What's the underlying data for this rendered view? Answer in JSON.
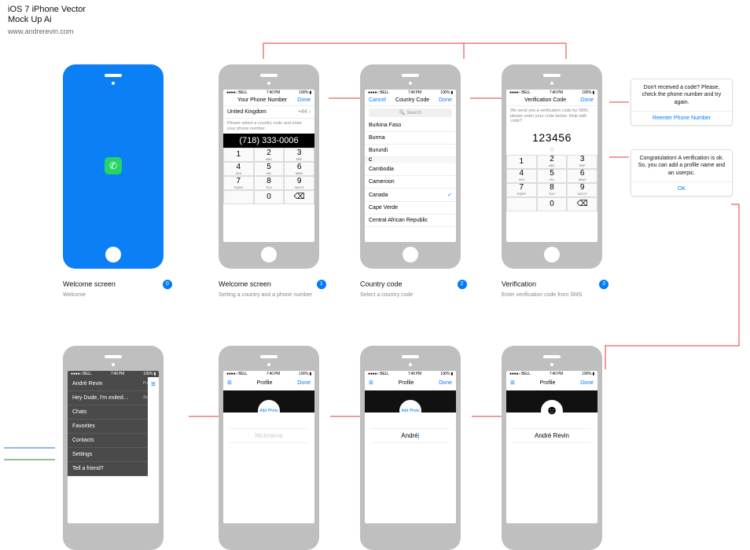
{
  "header": {
    "title": "iOS 7 iPhone Vector",
    "subtitle": "Mock Up Ai",
    "url": "www.andrerevin.com"
  },
  "statusbar": {
    "left": "●●●●○ BELL",
    "time": "7:40 PM",
    "right": "100%"
  },
  "screens": {
    "phone_number": {
      "nav_title": "Your Phone Number",
      "nav_done": "Done",
      "country": "United Kingdom",
      "prefix": "+44",
      "hint": "Please select a country code and enter your phone number.",
      "display": "(718) 333-0006"
    },
    "country_code": {
      "nav_cancel": "Cancel",
      "nav_title": "Country Code",
      "nav_done": "Done",
      "search_ph": "Search",
      "groupB": [
        "Burkina Faso",
        "Burma",
        "Burundi"
      ],
      "sect": "C",
      "groupC": [
        "Cambodia",
        "Cameroon",
        "Canada",
        "Cape Verde",
        "Central African Republic"
      ],
      "selected": "Canada"
    },
    "verification": {
      "nav_title": "Verification Code",
      "nav_done": "Done",
      "hint": "We send you a verification code by SMS, please enter your code below. Help with code?",
      "code": "123456"
    },
    "keypad": [
      {
        "d": "1",
        "l": ""
      },
      {
        "d": "2",
        "l": "ABC"
      },
      {
        "d": "3",
        "l": "DEF"
      },
      {
        "d": "4",
        "l": "GHI"
      },
      {
        "d": "5",
        "l": "JKL"
      },
      {
        "d": "6",
        "l": "MNO"
      },
      {
        "d": "7",
        "l": "PQRS"
      },
      {
        "d": "8",
        "l": "TUV"
      },
      {
        "d": "9",
        "l": "WXYZ"
      },
      {
        "d": "",
        "l": ""
      },
      {
        "d": "0",
        "l": ""
      },
      {
        "d": "⌫",
        "l": ""
      }
    ],
    "profile": {
      "nav_title": "Profile",
      "nav_done": "Done",
      "add_photo": "Add Photo",
      "nick_ph": "Nickname",
      "nick_typing": "André",
      "nick_full": "André Revin"
    }
  },
  "menu": {
    "name": "André Revin",
    "profile": "Profile",
    "status_text": "Hey Dude, I'm exited…",
    "status": "Status",
    "items": [
      "Chats",
      "Favorites",
      "Contacts",
      "Settings",
      "Tell a friend?"
    ]
  },
  "callouts": {
    "c1": {
      "text": "Don't received a code? Please, check the phone number and try again.",
      "btn": "Reenter Phone Number"
    },
    "c2": {
      "text": "Congratulation! A verification is ok. So, you can add a profile name and an userpic.",
      "btn": "OK"
    }
  },
  "captions": {
    "s0": {
      "title": "Welcome screen",
      "desc": "Welcome",
      "num": "0"
    },
    "s1": {
      "title": "Welcome screen",
      "desc": "Setting a country and a phone number",
      "num": "1"
    },
    "s2": {
      "title": "Country code",
      "desc": "Select a country code",
      "num": "2"
    },
    "s3": {
      "title": "Verification",
      "desc": "Enter verification code from SMS",
      "num": "3"
    }
  }
}
